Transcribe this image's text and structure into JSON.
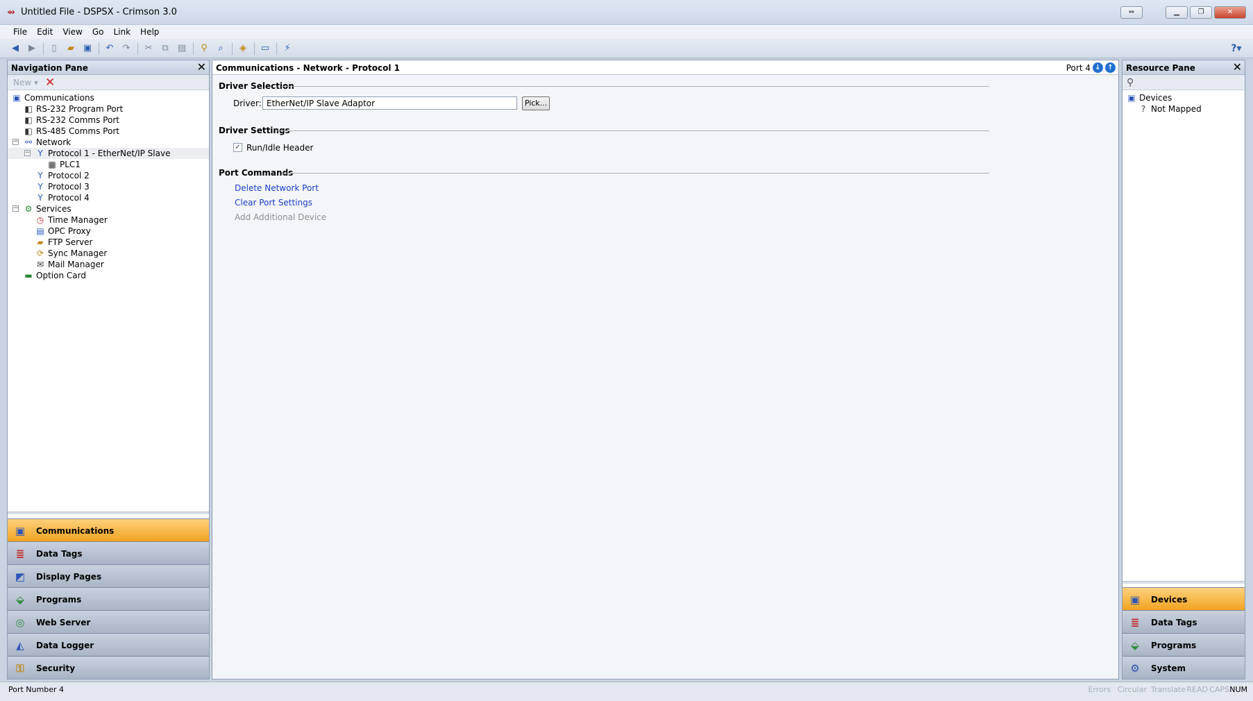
{
  "window": {
    "title": "Untitled File - DSPSX - Crimson 3.0",
    "app_icon": "crimson-logo-icon"
  },
  "menu": [
    "File",
    "Edit",
    "View",
    "Go",
    "Link",
    "Help"
  ],
  "toolbar": {
    "icons": [
      "back-icon",
      "forward-icon",
      "new-file-icon",
      "open-folder-icon",
      "save-icon",
      "undo-icon",
      "redo-icon",
      "cut-icon",
      "copy-icon",
      "paste-icon",
      "find-icon",
      "find-replace-icon",
      "translate-icon",
      "display-icon",
      "link-icon"
    ],
    "help_icon": "help-icon"
  },
  "nav_pane": {
    "title": "Navigation Pane",
    "new_label": "New",
    "tree": [
      {
        "label": "Communications",
        "level": 0,
        "icon": "communications-icon",
        "expander": ""
      },
      {
        "label": "RS-232 Program Port",
        "level": 1,
        "icon": "serial-port-icon",
        "expander": ""
      },
      {
        "label": "RS-232 Comms Port",
        "level": 1,
        "icon": "serial-port-icon",
        "expander": ""
      },
      {
        "label": "RS-485 Comms Port",
        "level": 1,
        "icon": "serial-port-icon",
        "expander": ""
      },
      {
        "label": "Network",
        "level": 1,
        "icon": "network-icon",
        "expander": "−"
      },
      {
        "label": "Protocol 1 - EtherNet/IP Slave",
        "level": 2,
        "icon": "protocol-icon",
        "expander": "−",
        "selected": true
      },
      {
        "label": "PLC1",
        "level": 3,
        "icon": "device-icon",
        "expander": ""
      },
      {
        "label": "Protocol 2",
        "level": 2,
        "icon": "protocol-icon",
        "expander": ""
      },
      {
        "label": "Protocol 3",
        "level": 2,
        "icon": "protocol-icon",
        "expander": ""
      },
      {
        "label": "Protocol 4",
        "level": 2,
        "icon": "protocol-icon",
        "expander": ""
      },
      {
        "label": "Services",
        "level": 1,
        "icon": "services-icon",
        "expander": "−"
      },
      {
        "label": "Time Manager",
        "level": 2,
        "icon": "time-manager-icon",
        "expander": ""
      },
      {
        "label": "OPC Proxy",
        "level": 2,
        "icon": "opc-proxy-icon",
        "expander": ""
      },
      {
        "label": "FTP Server",
        "level": 2,
        "icon": "ftp-server-icon",
        "expander": ""
      },
      {
        "label": "Sync Manager",
        "level": 2,
        "icon": "sync-manager-icon",
        "expander": ""
      },
      {
        "label": "Mail Manager",
        "level": 2,
        "icon": "mail-manager-icon",
        "expander": ""
      },
      {
        "label": "Option Card",
        "level": 1,
        "icon": "option-card-icon",
        "expander": ""
      }
    ],
    "categories": [
      {
        "label": "Communications",
        "icon": "communications-icon",
        "active": true
      },
      {
        "label": "Data Tags",
        "icon": "data-tags-icon"
      },
      {
        "label": "Display Pages",
        "icon": "display-pages-icon"
      },
      {
        "label": "Programs",
        "icon": "programs-icon"
      },
      {
        "label": "Web Server",
        "icon": "web-server-icon"
      },
      {
        "label": "Data Logger",
        "icon": "data-logger-icon"
      },
      {
        "label": "Security",
        "icon": "security-icon"
      }
    ]
  },
  "main": {
    "breadcrumb": "Communications - Network - Protocol 1",
    "port_label": "Port 4",
    "driver_selection": {
      "title": "Driver Selection",
      "driver_label": "Driver:",
      "driver_value": "EtherNet/IP Slave Adaptor",
      "pick_label": "Pick..."
    },
    "driver_settings": {
      "title": "Driver Settings",
      "run_idle_label": "Run/Idle Header",
      "run_idle_checked": true
    },
    "port_commands": {
      "title": "Port Commands",
      "delete_label": "Delete Network Port",
      "clear_label": "Clear Port Settings",
      "add_label": "Add Additional Device"
    }
  },
  "resource_pane": {
    "title": "Resource Pane",
    "tree": [
      {
        "label": "Devices",
        "level": 0,
        "icon": "devices-icon"
      },
      {
        "label": "Not Mapped",
        "level": 1,
        "icon": "question-icon"
      }
    ],
    "categories": [
      {
        "label": "Devices",
        "icon": "devices-icon",
        "active": true
      },
      {
        "label": "Data Tags",
        "icon": "data-tags-icon"
      },
      {
        "label": "Programs",
        "icon": "programs-icon"
      },
      {
        "label": "System",
        "icon": "system-icon"
      }
    ]
  },
  "status": {
    "text": "Port Number 4",
    "indicators": [
      {
        "label": "Errors",
        "on": false
      },
      {
        "label": "Circular",
        "on": false
      },
      {
        "label": "Translate",
        "on": false
      },
      {
        "label": "READ",
        "on": false
      },
      {
        "label": "CAPS",
        "on": false
      },
      {
        "label": "NUM",
        "on": true
      }
    ]
  }
}
